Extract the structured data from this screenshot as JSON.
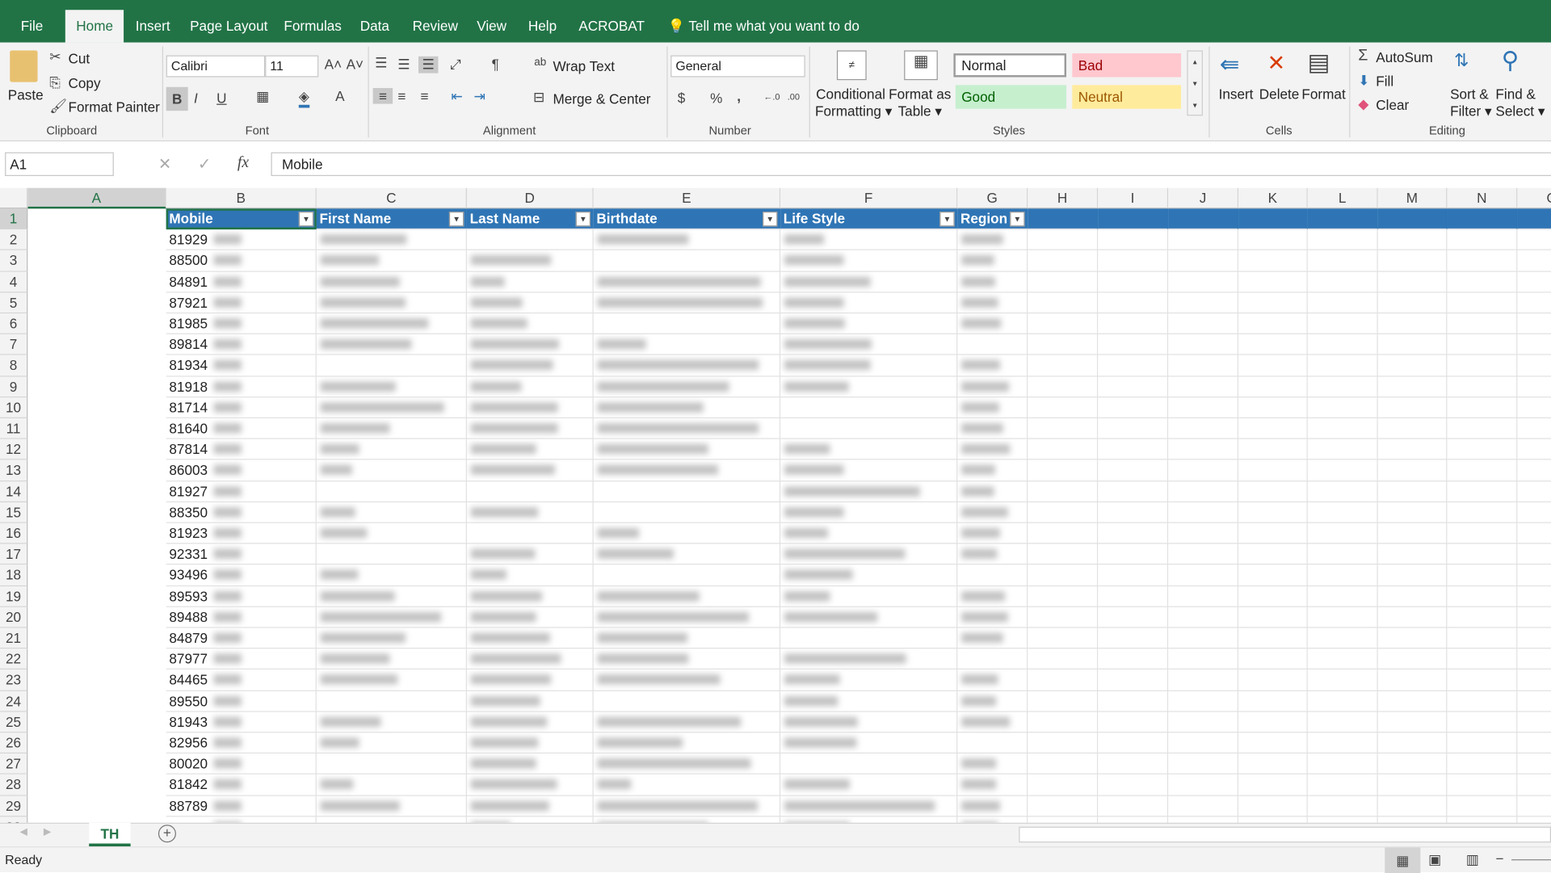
{
  "ribbon_tabs": [
    "File",
    "Home",
    "Insert",
    "Page Layout",
    "Formulas",
    "Data",
    "Review",
    "View",
    "Help",
    "ACROBAT"
  ],
  "tell_me": "Tell me what you want to do",
  "clipboard": {
    "paste": "Paste",
    "cut": "Cut",
    "copy": "Copy",
    "format_painter": "Format Painter",
    "group": "Clipboard"
  },
  "font": {
    "name": "Calibri",
    "size": "11",
    "group": "Font",
    "bold": "B",
    "italic": "I",
    "underline": "U",
    "color": "A"
  },
  "alignment": {
    "wrap": "Wrap Text",
    "merge": "Merge & Center",
    "group": "Alignment"
  },
  "number": {
    "format": "General",
    "currency": "$",
    "percent": "%",
    "comma": ",",
    "group": "Number"
  },
  "styles": {
    "cond": "Conditional",
    "cond2": "Formatting",
    "fmt_table": "Format as",
    "fmt_table2": "Table",
    "normal": "Normal",
    "bad": "Bad",
    "good": "Good",
    "neutral": "Neutral",
    "group": "Styles"
  },
  "cells": {
    "insert": "Insert",
    "delete": "Delete",
    "format": "Format",
    "group": "Cells"
  },
  "editing": {
    "autosum": "AutoSum",
    "fill": "Fill",
    "clear": "Clear",
    "sort": "Sort &",
    "sort2": "Filter",
    "find": "Find &",
    "find2": "Select",
    "group": "Editing"
  },
  "formula_bar": {
    "name_box": "A1",
    "fx": "fx",
    "value": "Mobile"
  },
  "columns": [
    "A",
    "B",
    "C",
    "D",
    "E",
    "F",
    "G",
    "H",
    "I",
    "J",
    "K",
    "L",
    "M",
    "N",
    "O"
  ],
  "table_headers": [
    "Mobile",
    "First Name",
    "Last Name",
    "Birthdate",
    "Life Style",
    "Region"
  ],
  "mobile_visible": [
    "81929",
    "88500",
    "84891",
    "87921",
    "81985",
    "89814",
    "81934",
    "81918",
    "81714",
    "81640",
    "87814",
    "86003",
    "81927",
    "88350",
    "81923",
    "92331",
    "93496",
    "89593",
    "89488",
    "84879",
    "87977",
    "84465",
    "89550",
    "81943",
    "82956",
    "80020",
    "81842",
    "88789"
  ],
  "sheet_tab": "TH",
  "status": "Ready",
  "colors": {
    "accent": "#217346",
    "table_header": "#2f75b5"
  }
}
